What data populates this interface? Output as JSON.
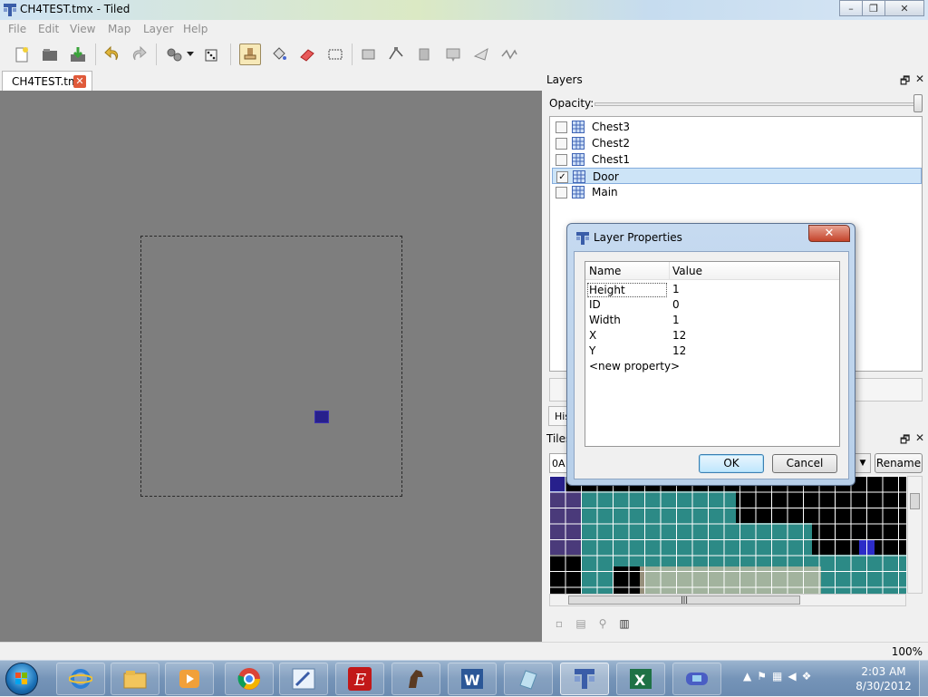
{
  "window": {
    "title": "CH4TEST.tmx - Tiled",
    "minimize": "–",
    "maximize": "❐",
    "close": "✕"
  },
  "menu": [
    "File",
    "Edit",
    "View",
    "Map",
    "Layer",
    "Help"
  ],
  "toolbar_icons": [
    "new-icon",
    "open-icon",
    "save-icon",
    "undo-icon",
    "redo-icon",
    "command-icon",
    "dropdown-arrow-icon",
    "random-icon",
    "stamp-brush-icon",
    "bucket-fill-icon",
    "eraser-icon",
    "rectangle-select-icon",
    "select-objects-icon",
    "edit-polygons-icon",
    "insert-rectangle-icon",
    "insert-image-icon",
    "insert-polygon-icon",
    "insert-polyline-icon"
  ],
  "document_tab": {
    "label": "CH4TEST.tmx",
    "close": "✕"
  },
  "layers_panel": {
    "title": "Layers",
    "opacity_label": "Opacity:",
    "opacity_value": 1.0,
    "layers": [
      {
        "name": "Chest3",
        "checked": false,
        "selected": false
      },
      {
        "name": "Chest2",
        "checked": false,
        "selected": false
      },
      {
        "name": "Chest1",
        "checked": false,
        "selected": false
      },
      {
        "name": "Door",
        "checked": true,
        "selected": true
      },
      {
        "name": "Main",
        "checked": false,
        "selected": false
      }
    ],
    "check_mark": "✓"
  },
  "bottom_tabs": {
    "history_label": "His"
  },
  "tilesets_panel": {
    "title": "Tiles",
    "tileset_name": "0A",
    "rename_label": "Rename"
  },
  "panel_buttons": {
    "float": "🗗",
    "close": "✕"
  },
  "status": {
    "zoom": "100%"
  },
  "dialog": {
    "title": "Layer Properties",
    "close": "✕",
    "columns": {
      "name": "Name",
      "value": "Value"
    },
    "properties": [
      {
        "name": "Height",
        "value": "1"
      },
      {
        "name": "ID",
        "value": "0"
      },
      {
        "name": "Width",
        "value": "1"
      },
      {
        "name": "X",
        "value": "12"
      },
      {
        "name": "Y",
        "value": "12"
      }
    ],
    "new_property": "<new property>",
    "ok_label": "OK",
    "cancel_label": "Cancel"
  },
  "taskbar": {
    "apps": [
      "internet-explorer-icon",
      "file-explorer-icon",
      "media-player-icon",
      "chrome-icon",
      "paint-icon",
      "e-app-icon",
      "horse-app-icon",
      "word-icon",
      "notepad-icon",
      "tiled-icon",
      "excel-icon",
      "gameboy-icon"
    ],
    "time": "2:03 AM",
    "date": "8/30/2012"
  }
}
